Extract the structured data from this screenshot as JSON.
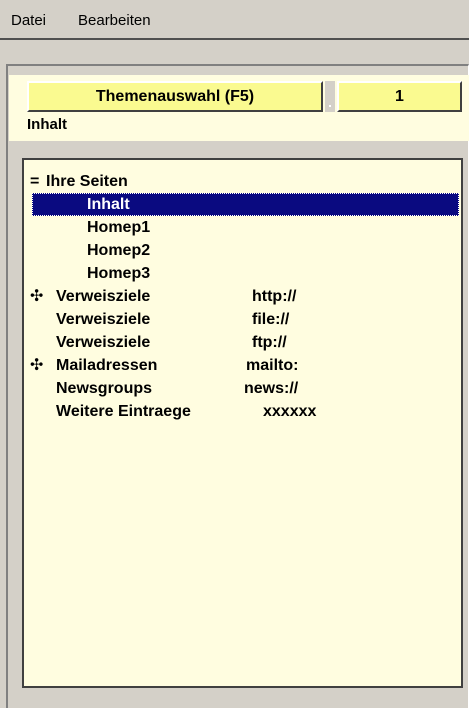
{
  "menu": {
    "items": [
      "Datei",
      "Bearbeiten"
    ]
  },
  "header": {
    "topic_button_label": "Themenauswahl (F5)",
    "page_number": "1",
    "current_topic": "Inhalt"
  },
  "tree": {
    "root": {
      "icon": "minus",
      "label": "Ihre Seiten"
    },
    "pages": [
      "Inhalt",
      "Homep1",
      "Homep2",
      "Homep3"
    ],
    "selected": "Inhalt",
    "links": [
      {
        "icon": "plus",
        "label": "Verweisziele",
        "protocol": "http://"
      },
      {
        "icon": "",
        "label": "Verweisziele",
        "protocol": "file://"
      },
      {
        "icon": "",
        "label": "Verweisziele",
        "protocol": "ftp://"
      },
      {
        "icon": "plus",
        "label": "Mailadressen",
        "protocol": "mailto:"
      },
      {
        "icon": "",
        "label": "Newsgroups",
        "protocol": "news://"
      },
      {
        "icon": "",
        "label": "Weitere Eintraege",
        "protocol": "xxxxxx"
      }
    ]
  },
  "colors": {
    "panel_bg": "#fffde0",
    "button_bg": "#fafa90",
    "selection": "#0a0a80",
    "window_bg": "#d4d0c8"
  }
}
